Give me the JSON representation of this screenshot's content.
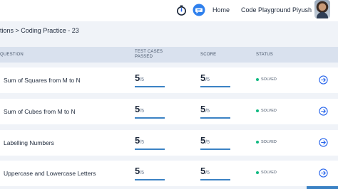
{
  "header": {
    "nav": {
      "home": "Home",
      "code_playground": "Code Playground",
      "user_name": "Piyush"
    },
    "icons": [
      "stopwatch-icon",
      "chat-icon"
    ]
  },
  "breadcrumb": "tions > Coding Practice - 23",
  "table": {
    "columns": {
      "question": "QUESTION",
      "test_cases_line1": "TEST CASES",
      "test_cases_line2": "PASSED",
      "score": "SCORE",
      "status": "STATUS"
    },
    "rows": [
      {
        "title": "Sum of Squares from M to N",
        "passed": "5",
        "passed_total": "/5",
        "score": "5",
        "score_total": "/5",
        "status": "SOLVED",
        "progress": 1.0
      },
      {
        "title": "Sum of Cubes from M to N",
        "passed": "5",
        "passed_total": "/5",
        "score": "5",
        "score_total": "/5",
        "status": "SOLVED",
        "progress": 1.0
      },
      {
        "title": "Labelling Numbers",
        "passed": "5",
        "passed_total": "/5",
        "score": "5",
        "score_total": "/5",
        "status": "SOLVED",
        "progress": 1.0
      },
      {
        "title": "Uppercase and Lowercase Letters",
        "passed": "5",
        "passed_total": "/5",
        "score": "5",
        "score_total": "/5",
        "status": "SOLVED",
        "progress": 1.0
      }
    ]
  },
  "colors": {
    "accent": "#3b82c4",
    "solved": "#10b981",
    "header_bg": "#d9e1ee",
    "page_bg": "#f0f3f8"
  }
}
